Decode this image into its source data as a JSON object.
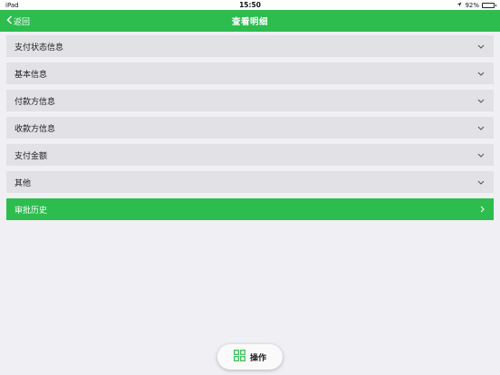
{
  "status_bar": {
    "device": "iPad",
    "time": "15:50",
    "battery": "92%",
    "battery_level": 0.92
  },
  "navbar": {
    "back_label": "返回",
    "title": "查看明细"
  },
  "sections": [
    {
      "label": "支付状态信息",
      "icon": "chevron-down-icon"
    },
    {
      "label": "基本信息",
      "icon": "chevron-down-icon"
    },
    {
      "label": "付款方信息",
      "icon": "chevron-down-icon"
    },
    {
      "label": "收款方信息",
      "icon": "chevron-down-icon"
    },
    {
      "label": "支付金额",
      "icon": "chevron-down-icon"
    },
    {
      "label": "其他",
      "icon": "chevron-down-icon"
    }
  ],
  "approval_history": {
    "label": "审批历史",
    "icon": "chevron-right-icon"
  },
  "action_button": {
    "label": "操作",
    "icon": "grid-icon"
  },
  "colors": {
    "accent": "#2dbd4e",
    "row_bg": "#e1e1e6",
    "page_bg": "#efeff4"
  }
}
